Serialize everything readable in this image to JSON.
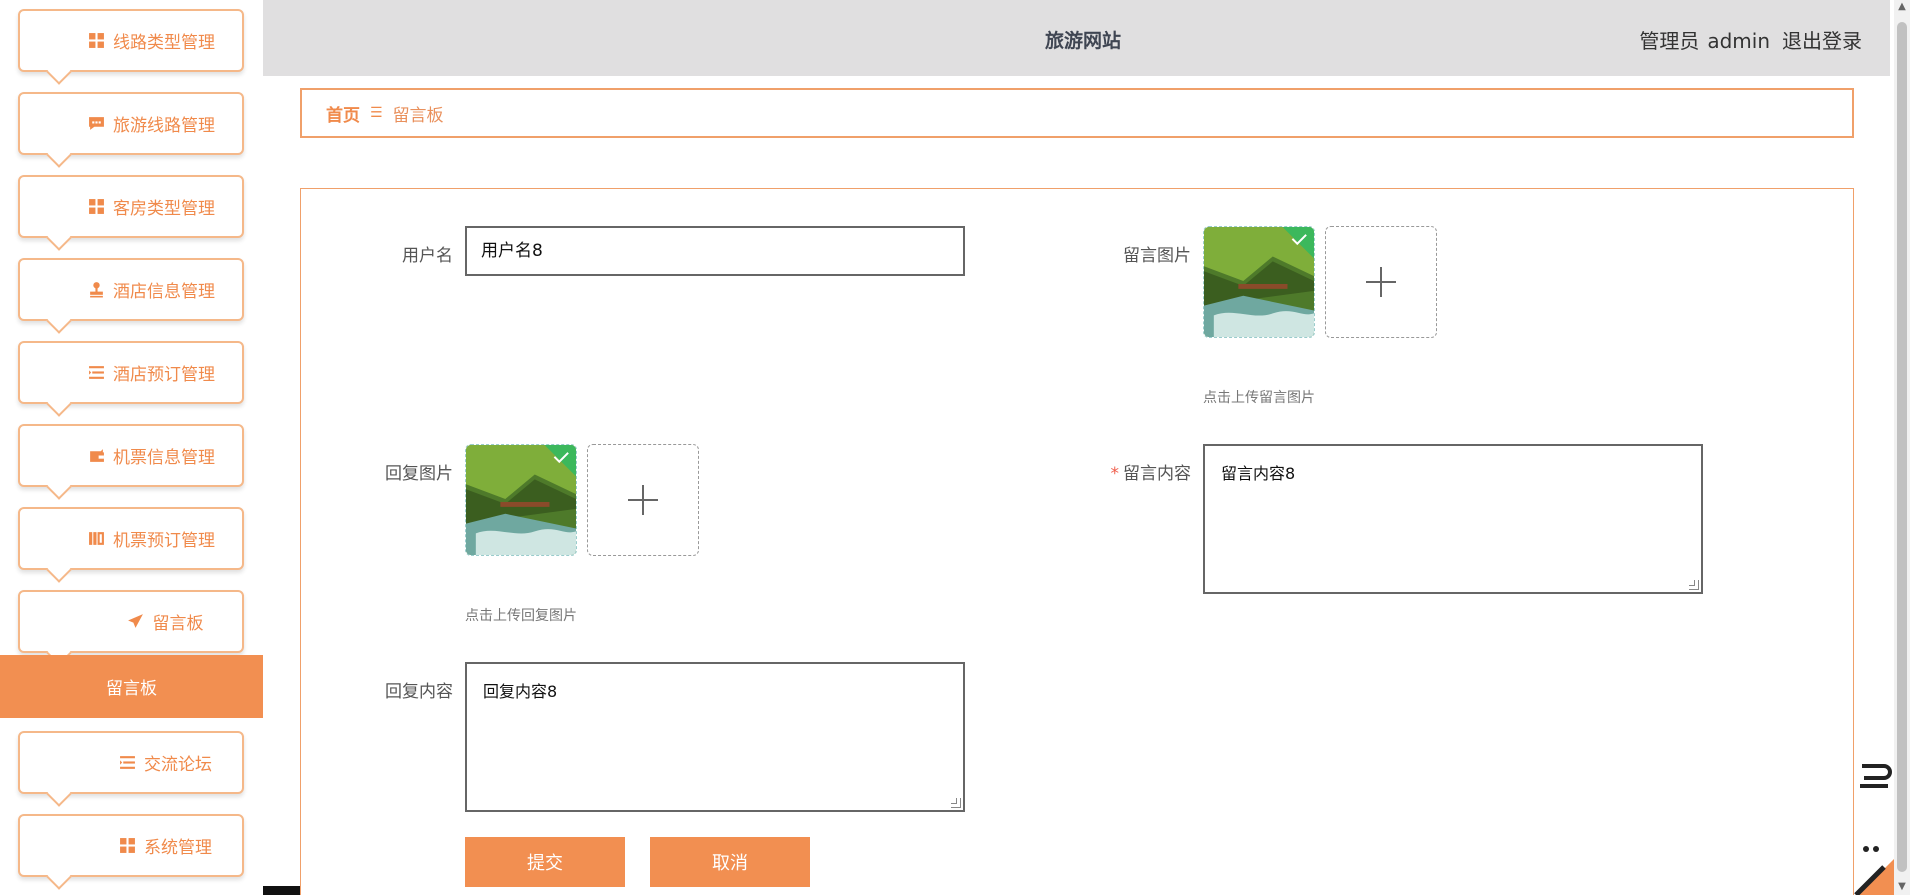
{
  "header": {
    "site_title": "旅游网站",
    "user_role": "管理员",
    "username": "admin",
    "logout_label": "退出登录"
  },
  "sidebar": {
    "items": [
      {
        "label": "线路类型管理",
        "icon": "grid-icon"
      },
      {
        "label": "旅游线路管理",
        "icon": "chat-icon"
      },
      {
        "label": "客房类型管理",
        "icon": "grid-icon"
      },
      {
        "label": "酒店信息管理",
        "icon": "stamp-icon"
      },
      {
        "label": "酒店预订管理",
        "icon": "list-icon"
      },
      {
        "label": "机票信息管理",
        "icon": "wallet-icon"
      },
      {
        "label": "机票预订管理",
        "icon": "book-icon"
      },
      {
        "label": "留言板",
        "icon": "send-icon"
      },
      {
        "label": "交流论坛",
        "icon": "list-icon"
      },
      {
        "label": "系统管理",
        "icon": "grid-icon"
      }
    ],
    "active_sub_item": "留言板"
  },
  "breadcrumb": {
    "home": "首页",
    "separator": "☰",
    "current": "留言板"
  },
  "form": {
    "username_label": "用户名",
    "username_value": "用户名8",
    "message_image_label": "留言图片",
    "message_image_hint": "点击上传留言图片",
    "reply_image_label": "回复图片",
    "reply_image_hint": "点击上传回复图片",
    "message_content_label": "留言内容",
    "message_content_required_mark": "*",
    "message_content_value": "留言内容8",
    "reply_content_label": "回复内容",
    "reply_content_value": "回复内容8",
    "submit_label": "提交",
    "cancel_label": "取消"
  },
  "colors": {
    "accent": "#f28f51",
    "accent_border": "#f0a06a",
    "header_bg": "#e0dfe0"
  }
}
